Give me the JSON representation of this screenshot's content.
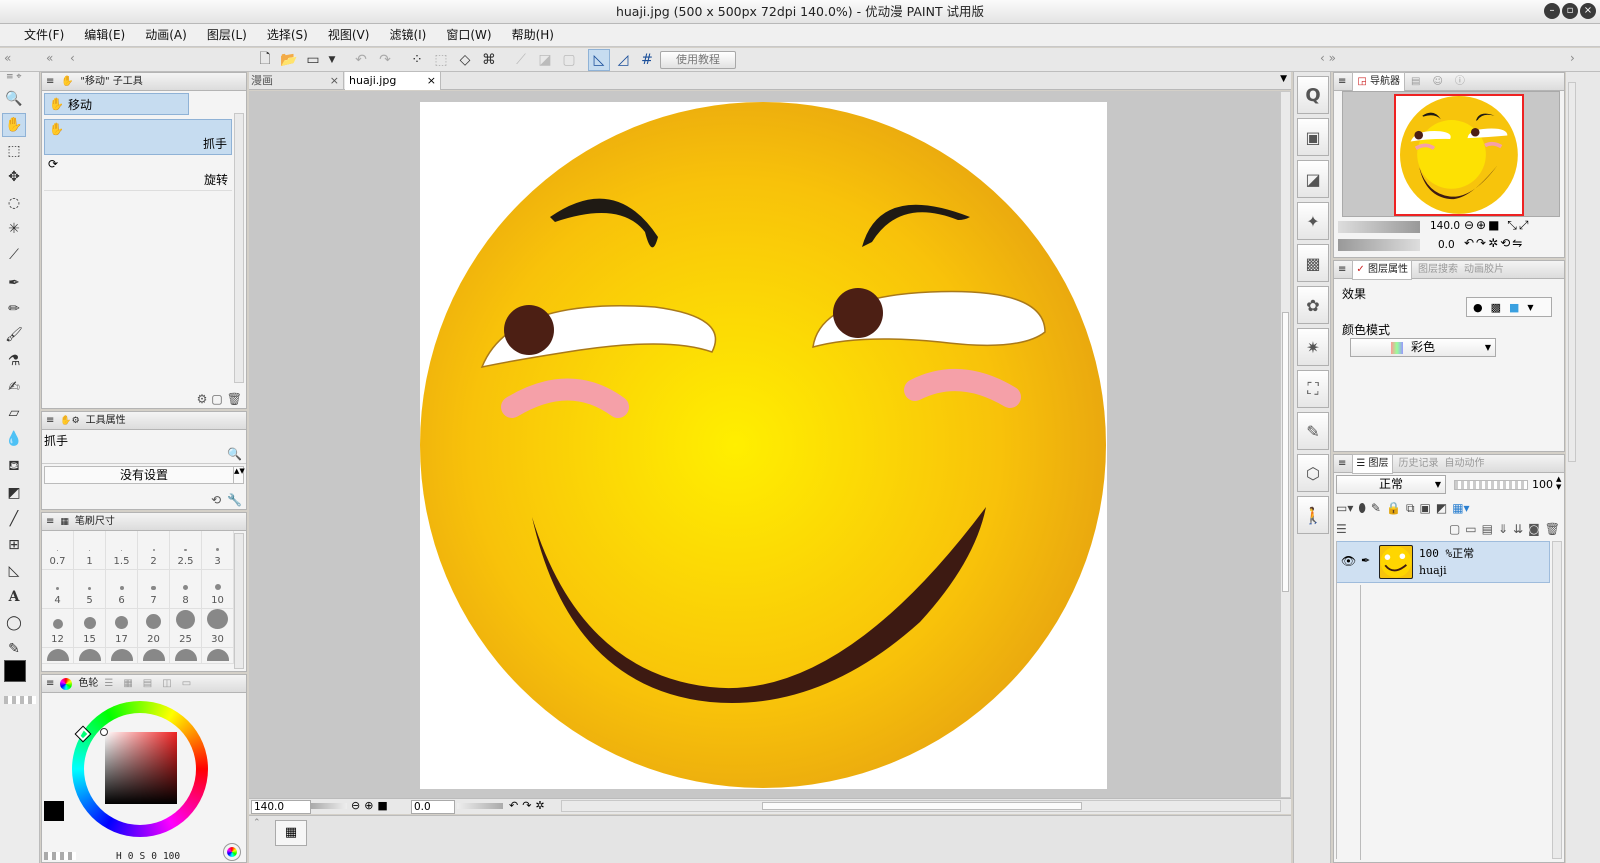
{
  "window": {
    "title": "huaji.jpg (500 x 500px 72dpi 140.0%)  - 优动漫 PAINT 试用版"
  },
  "menu": [
    "文件(F)",
    "编辑(E)",
    "动画(A)",
    "图层(L)",
    "选择(S)",
    "视图(V)",
    "滤镜(I)",
    "窗口(W)",
    "帮助(H)"
  ],
  "toolbar": {
    "tutorial_label": "使用教程"
  },
  "subtool": {
    "header": "\"移动\" 子工具",
    "group": "移动",
    "items": [
      {
        "label": "抓手"
      },
      {
        "label": "旋转"
      }
    ]
  },
  "tool_property": {
    "header": "工具属性",
    "tool_name": "抓手",
    "no_setting": "没有设置"
  },
  "brush_size": {
    "header": "笔刷尺寸",
    "sizes": [
      "0.7",
      "1",
      "1.5",
      "2",
      "2.5",
      "3",
      "4",
      "5",
      "6",
      "7",
      "8",
      "10",
      "12",
      "15",
      "17",
      "20",
      "25",
      "30"
    ]
  },
  "color_panel": {
    "header": "色轮",
    "hsv_s": "0",
    "hsv_v": "0",
    "value": "100",
    "pick_color": "#000000"
  },
  "tabs": [
    {
      "label": "漫画"
    },
    {
      "label": "huaji.jpg"
    }
  ],
  "canvas_status": {
    "zoom": "140.0",
    "rotation": "0.0"
  },
  "navigator": {
    "header": "导航器",
    "zoom": "140.0",
    "angle": "0.0"
  },
  "layer_property": {
    "header": "图层属性",
    "search_tab": "图层搜索",
    "anim_tab": "动画胶片",
    "effect_label": "效果",
    "color_mode_label": "颜色模式",
    "color_mode_value": "彩色"
  },
  "layers_panel": {
    "header": "图层",
    "history_tab": "历史记录",
    "auto_action_tab": "自动动作",
    "blend_mode": "正常",
    "opacity": "100",
    "layers": [
      {
        "opacity_mode": "100 %正常",
        "name": "huaji"
      }
    ]
  }
}
